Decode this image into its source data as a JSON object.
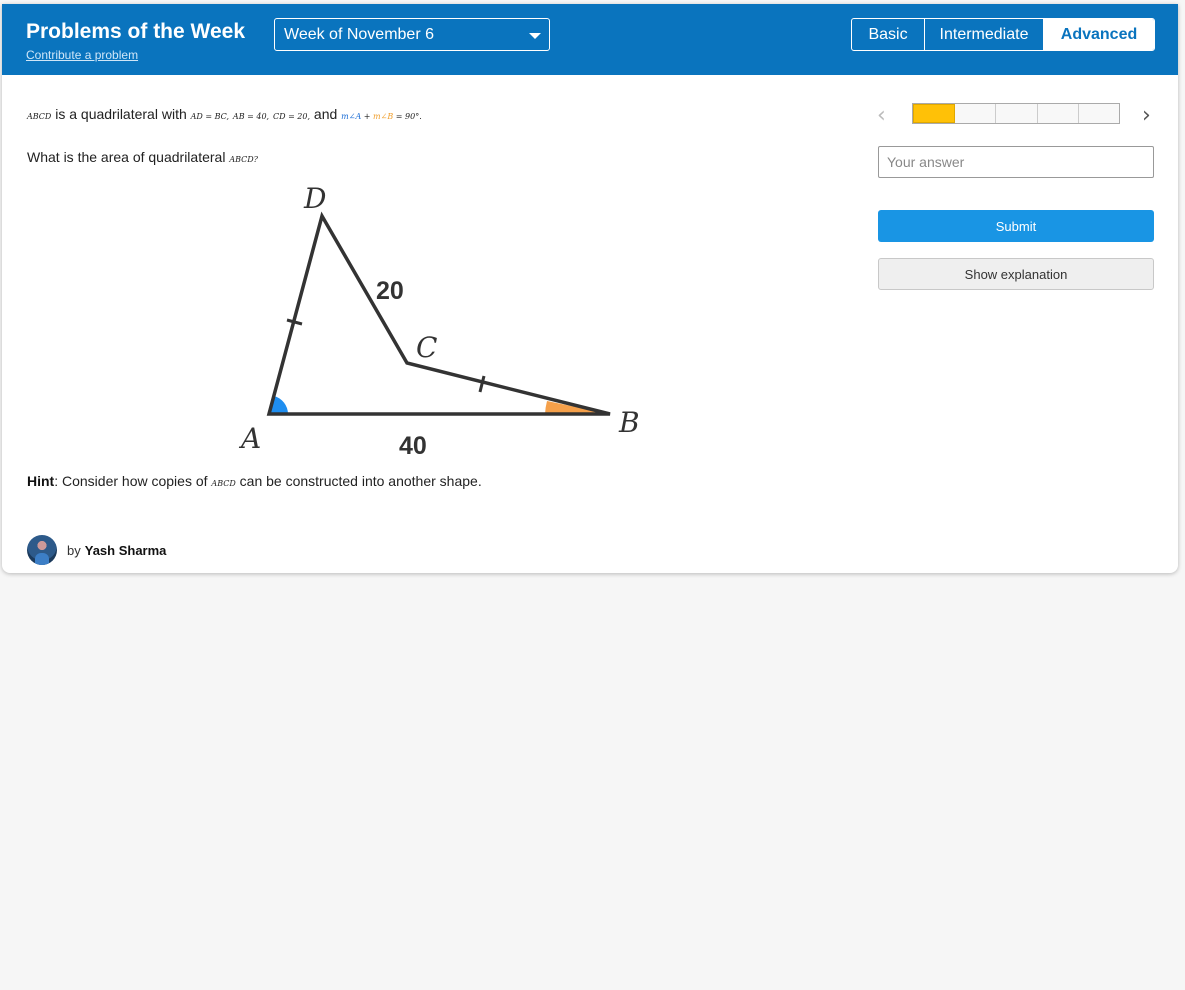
{
  "header": {
    "title": "Problems of the Week",
    "contribute": "Contribute a problem",
    "week": "Week of November 6",
    "levels": [
      "Basic",
      "Intermediate",
      "Advanced"
    ],
    "active_level": "Advanced"
  },
  "problem": {
    "quad": "ABCD",
    "text1": " is a quadrilateral with ",
    "cond1": "AD = BC,",
    "cond2": "AB = 40,",
    "cond3": "CD = 20,",
    "and": " and ",
    "angle_a": "m∠A",
    "plus": " + ",
    "angle_b": "m∠B",
    "angle_eq": " = 90°.",
    "question": "What is the area of quadrilateral ",
    "question_quad": "ABCD?",
    "hint_label": "Hint",
    "hint_text": ": Consider how copies of ",
    "hint_quad": "ABCD",
    "hint_tail": " can be constructed into another shape."
  },
  "figure": {
    "label_a": "A",
    "label_b": "B",
    "label_c": "C",
    "label_d": "D",
    "len_ab": "40",
    "len_cd": "20"
  },
  "author": {
    "by": "by",
    "name": "Yash Sharma"
  },
  "sidebar": {
    "answer_placeholder": "Your answer",
    "submit_label": "Submit",
    "explain_label": "Show explanation",
    "progress_total": 5,
    "progress_current": 1
  },
  "colors": {
    "header": "#0a74be",
    "progress_done": "#ffc107",
    "submit": "#1995e4",
    "angle_a": "#1f8ef0",
    "angle_b": "#f5a04a"
  }
}
